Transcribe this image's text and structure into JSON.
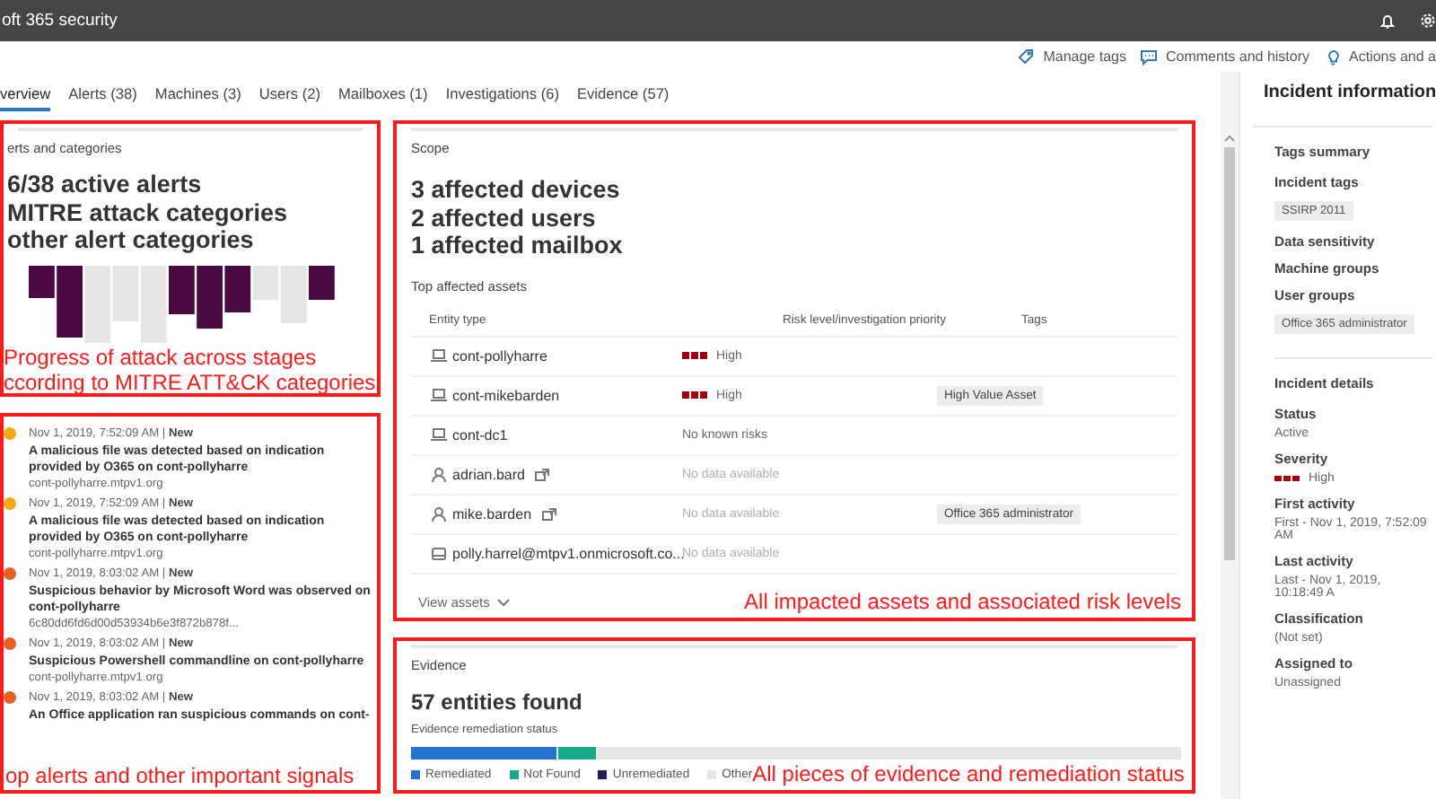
{
  "app": {
    "title": "oft 365 security"
  },
  "header_actions": [
    {
      "label": "Manage tags"
    },
    {
      "label": "Comments and history"
    },
    {
      "label": "Actions and a"
    }
  ],
  "tabs": [
    {
      "label": "verview",
      "selected": true
    },
    {
      "label": "Alerts (38)",
      "selected": false
    },
    {
      "label": "Machines (3)",
      "selected": false
    },
    {
      "label": "Users (2)",
      "selected": false
    },
    {
      "label": "Mailboxes (1)",
      "selected": false
    },
    {
      "label": "Investigations (6)",
      "selected": false
    },
    {
      "label": "Evidence (57)",
      "selected": false
    }
  ],
  "alerts_summary": {
    "heading": "erts and categories",
    "stats": [
      "6/38 active alerts",
      "MITRE attack categories",
      "other alert categories"
    ],
    "annotation": [
      "Progress of attack across stages",
      "ccording to MITRE ATT&CK categories"
    ]
  },
  "alert_list": {
    "items": [
      {
        "color": "#f6a912",
        "time": "Nov 1, 2019, 7:52:09 AM | **New**",
        "title": "A malicious file was detected based on indication provided by O365 on cont-pollyharre",
        "host": "cont-pollyharre.mtpv1.org"
      },
      {
        "color": "#f6a912",
        "time": "Nov 1, 2019, 7:52:09 AM | **New**",
        "title": "A malicious file was detected based on indication provided by O365 on cont-pollyharre",
        "host": "cont-pollyharre.mtpv1.org"
      },
      {
        "color": "#e8601c",
        "time": "Nov 1, 2019, 8:03:02 AM | **New**",
        "title": "Suspicious behavior by Microsoft Word was observed on cont-pollyharre",
        "host": "6c80dd6fd6d00d53934b6e3f872b878f..."
      },
      {
        "color": "#e8601c",
        "time": "Nov 1, 2019, 8:03:02 AM | **New**",
        "title": "Suspicious Powershell commandline on cont-pollyharre",
        "host": "cont-pollyharre.mtpv1.org"
      },
      {
        "color": "#e8601c",
        "time": "Nov 1, 2019, 8:03:02 AM | **New**",
        "title": "An Office application ran suspicious commands on cont-"
      }
    ],
    "annotation": "op alerts and other important signals"
  },
  "scope": {
    "heading": "Scope",
    "stats": [
      "3 affected devices",
      "2 affected users",
      "1 affected mailbox"
    ],
    "assets_title": "Top affected assets",
    "columns": [
      "Entity type",
      "Risk level/investigation priority",
      "Tags"
    ],
    "rows": [
      {
        "kind": "machine",
        "name": "cont-pollyharre",
        "risk_bars": true,
        "muted": false,
        "risk": "High"
      },
      {
        "kind": "machine",
        "name": "cont-mikebarden",
        "risk_bars": true,
        "muted": false,
        "risk": "High",
        "tag": "High Value Asset"
      },
      {
        "kind": "machine",
        "name": "cont-dc1",
        "risk_bars": false,
        "muted": false,
        "risk": "No known risks"
      },
      {
        "kind": "user",
        "name": "adrian.bard",
        "risk_bars": false,
        "muted": true,
        "risk": "No data available"
      },
      {
        "kind": "user",
        "name": "mike.barden",
        "risk_bars": false,
        "muted": true,
        "risk": "No data available",
        "tag": "Office 365 administrator"
      },
      {
        "kind": "mailbox",
        "name": "polly.harrel@mtpv1.onmicrosoft.co...",
        "risk_bars": false,
        "muted": true,
        "risk": "No data available"
      }
    ],
    "view_assets": "View assets",
    "annotation": "All impacted assets and associated risk levels"
  },
  "evidence": {
    "heading": "Evidence",
    "count": "57 entities found",
    "status_title": "Evidence remediation status",
    "legend": [
      {
        "label": "Remediated",
        "color": "#2374d0"
      },
      {
        "label": "Not Found",
        "color": "#16a98c"
      },
      {
        "label": "Unremediated",
        "color": "#2b1b5e"
      },
      {
        "label": "Other",
        "color": "#e6e6e6"
      }
    ],
    "annotation": "All pieces of evidence and remediation status"
  },
  "incident_info": {
    "title": "Incident information",
    "tags_summary": {
      "heading": "Tags summary",
      "fields": [
        {
          "label": "Incident tags",
          "chips": [
            "SSIRP 2011"
          ]
        },
        {
          "label": "Data sensitivity"
        },
        {
          "label": "Machine groups"
        },
        {
          "label": "User groups",
          "chips": [
            "Office 365 administrator"
          ]
        }
      ]
    },
    "details": {
      "heading": "Incident details",
      "fields": [
        {
          "label": "Status",
          "value": "Active"
        },
        {
          "label": "Severity",
          "value": "High",
          "severity_bars": true
        },
        {
          "label": "First activity",
          "value": "First - Nov 1, 2019, 7:52:09 AM"
        },
        {
          "label": "Last activity",
          "value": "Last - Nov 1, 2019, 10:18:49 A"
        },
        {
          "label": "Classification",
          "value": "(Not set)"
        },
        {
          "label": "Assigned to",
          "value": "Unassigned"
        }
      ]
    }
  }
}
